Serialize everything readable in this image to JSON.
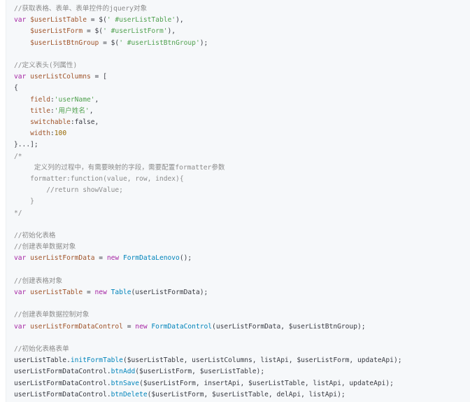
{
  "code_block": {
    "lines": [
      {
        "segments": [
          {
            "type": "comment",
            "text": "//获取表格、表单、表单控件的jquery对象"
          }
        ]
      },
      {
        "segments": [
          {
            "type": "keyword",
            "text": "var "
          },
          {
            "type": "var",
            "text": "$userListTable"
          },
          {
            "type": "plain",
            "text": " = $("
          },
          {
            "type": "string",
            "text": "' #userListTable'"
          },
          {
            "type": "plain",
            "text": "),"
          }
        ]
      },
      {
        "segments": [
          {
            "type": "plain",
            "text": "    "
          },
          {
            "type": "var",
            "text": "$userListForm"
          },
          {
            "type": "plain",
            "text": " = $("
          },
          {
            "type": "string",
            "text": "' #userListForm'"
          },
          {
            "type": "plain",
            "text": "),"
          }
        ]
      },
      {
        "segments": [
          {
            "type": "plain",
            "text": "    "
          },
          {
            "type": "var",
            "text": "$userListBtnGroup"
          },
          {
            "type": "plain",
            "text": " = $("
          },
          {
            "type": "string",
            "text": "' #userListBtnGroup'"
          },
          {
            "type": "plain",
            "text": ");"
          }
        ]
      },
      {
        "segments": []
      },
      {
        "segments": [
          {
            "type": "comment",
            "text": "//定义表头(列属性)"
          }
        ]
      },
      {
        "segments": [
          {
            "type": "keyword",
            "text": "var "
          },
          {
            "type": "var",
            "text": "userListColumns"
          },
          {
            "type": "plain",
            "text": " = ["
          }
        ]
      },
      {
        "segments": [
          {
            "type": "plain",
            "text": "{"
          }
        ]
      },
      {
        "segments": [
          {
            "type": "plain",
            "text": "    "
          },
          {
            "type": "var",
            "text": "field"
          },
          {
            "type": "plain",
            "text": ":"
          },
          {
            "type": "string",
            "text": "'userName'"
          },
          {
            "type": "plain",
            "text": ","
          }
        ]
      },
      {
        "segments": [
          {
            "type": "plain",
            "text": "    "
          },
          {
            "type": "var",
            "text": "title"
          },
          {
            "type": "plain",
            "text": ":"
          },
          {
            "type": "string",
            "text": "'用户姓名'"
          },
          {
            "type": "plain",
            "text": ","
          }
        ]
      },
      {
        "segments": [
          {
            "type": "plain",
            "text": "    "
          },
          {
            "type": "var",
            "text": "switchable"
          },
          {
            "type": "plain",
            "text": ":false,"
          }
        ]
      },
      {
        "segments": [
          {
            "type": "plain",
            "text": "    "
          },
          {
            "type": "var",
            "text": "width"
          },
          {
            "type": "plain",
            "text": ":"
          },
          {
            "type": "number",
            "text": "100"
          }
        ]
      },
      {
        "segments": [
          {
            "type": "plain",
            "text": "}...];"
          }
        ]
      },
      {
        "segments": [
          {
            "type": "comment",
            "text": "/*"
          }
        ]
      },
      {
        "segments": [
          {
            "type": "comment",
            "text": "     定义列的过程中，有需要映射的字段，需要配置formatter参数"
          }
        ]
      },
      {
        "segments": [
          {
            "type": "comment",
            "text": "    formatter:function(value, row, index){"
          }
        ]
      },
      {
        "segments": [
          {
            "type": "comment",
            "text": "        //return showValue;"
          }
        ]
      },
      {
        "segments": [
          {
            "type": "comment",
            "text": "    }"
          }
        ]
      },
      {
        "segments": [
          {
            "type": "comment",
            "text": "*/"
          }
        ]
      },
      {
        "segments": []
      },
      {
        "segments": [
          {
            "type": "comment",
            "text": "//初始化表格"
          }
        ]
      },
      {
        "segments": [
          {
            "type": "comment",
            "text": "//创建表单数据对象"
          }
        ]
      },
      {
        "segments": [
          {
            "type": "keyword",
            "text": "var "
          },
          {
            "type": "var",
            "text": "userListFormData"
          },
          {
            "type": "plain",
            "text": " = "
          },
          {
            "type": "keyword",
            "text": "new "
          },
          {
            "type": "class",
            "text": "FormDataLenovo"
          },
          {
            "type": "plain",
            "text": "();"
          }
        ]
      },
      {
        "segments": []
      },
      {
        "segments": [
          {
            "type": "comment",
            "text": "//创建表格对象"
          }
        ]
      },
      {
        "segments": [
          {
            "type": "keyword",
            "text": "var "
          },
          {
            "type": "var",
            "text": "userListTable"
          },
          {
            "type": "plain",
            "text": " = "
          },
          {
            "type": "keyword",
            "text": "new "
          },
          {
            "type": "class",
            "text": "Table"
          },
          {
            "type": "plain",
            "text": "(userListFormData);"
          }
        ]
      },
      {
        "segments": []
      },
      {
        "segments": [
          {
            "type": "comment",
            "text": "//创建表单数据控制对象"
          }
        ]
      },
      {
        "segments": [
          {
            "type": "keyword",
            "text": "var "
          },
          {
            "type": "var",
            "text": "userListFormDataControl"
          },
          {
            "type": "plain",
            "text": " = "
          },
          {
            "type": "keyword",
            "text": "new "
          },
          {
            "type": "class",
            "text": "FormDataControl"
          },
          {
            "type": "plain",
            "text": "(userListFormData, $userListBtnGroup);"
          }
        ]
      },
      {
        "segments": []
      },
      {
        "segments": [
          {
            "type": "comment",
            "text": "//初始化表格表单"
          }
        ]
      },
      {
        "segments": [
          {
            "type": "plain",
            "text": "userListTable."
          },
          {
            "type": "class",
            "text": "initFormTable"
          },
          {
            "type": "plain",
            "text": "($userListTable, userListColumns, listApi, $userListForm, updateApi);"
          }
        ]
      },
      {
        "segments": [
          {
            "type": "plain",
            "text": "userListFormDataControl."
          },
          {
            "type": "class",
            "text": "btnAdd"
          },
          {
            "type": "plain",
            "text": "($userListForm, $userListTable);"
          }
        ]
      },
      {
        "segments": [
          {
            "type": "plain",
            "text": "userListFormDataControl."
          },
          {
            "type": "class",
            "text": "btnSave"
          },
          {
            "type": "plain",
            "text": "($userListForm, insertApi, $userListTable, listApi, updateApi);"
          }
        ]
      },
      {
        "segments": [
          {
            "type": "plain",
            "text": "userListFormDataControl."
          },
          {
            "type": "class",
            "text": "btnDelete"
          },
          {
            "type": "plain",
            "text": "($userListForm, $userListTable, delApi, listApi);"
          }
        ]
      }
    ]
  }
}
